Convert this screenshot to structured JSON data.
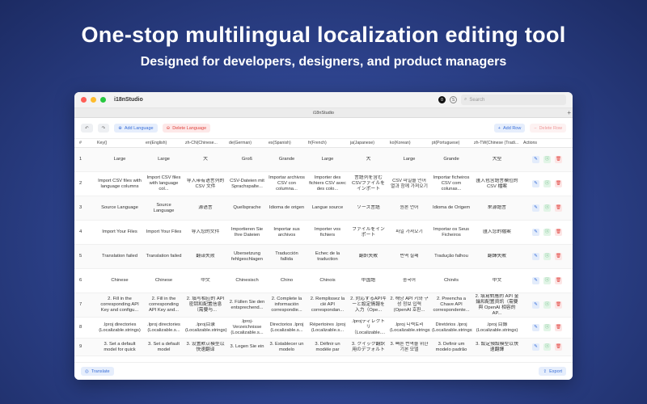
{
  "hero": {
    "title": "One-stop multilingual localization editing tool",
    "subtitle": "Designed for developers, designers, and product managers"
  },
  "window": {
    "app_name": "i18nStudio",
    "tab_title": "i18nStudio",
    "search_placeholder": "Search",
    "badge_left": "0",
    "badge_right": "S"
  },
  "toolbar": {
    "undo": "↶",
    "redo": "↷",
    "add_language": "Add Language",
    "delete_language": "Delete Language",
    "add_row": "Add Row",
    "delete_row": "Delete Row"
  },
  "table": {
    "headers": [
      "#",
      "Key()",
      "en(English)",
      "zh-CN(Chinese...",
      "de(German)",
      "es(Spanish)",
      "fr(French)",
      "ja(Japanese)",
      "ko(Korean)",
      "pt(Portuguese)",
      "zh-TW(Chinese (Tradi...",
      "Actions"
    ],
    "rows": [
      [
        "1",
        "Large",
        "Large",
        "大",
        "Groß",
        "Grande",
        "Large",
        "大",
        "Large",
        "Grande",
        "大型"
      ],
      [
        "2",
        "Import CSV files with language columns",
        "Import CSV files with language col...",
        "导入带有语言列的 CSV 文件",
        "CSV-Dateien mit Sprachspalte...",
        "Importar archivos CSV con columna...",
        "Importer des fichiers CSV avec des colo...",
        "言語列を含む CSVファイルをインポート",
        "CSV 파일을 언어 열과 함께 가져오기",
        "Importar ficheiros CSV com colunas...",
        "匯入包含語言欄位的 CSV 檔案"
      ],
      [
        "3",
        "Source Language",
        "Source Language",
        "源语言",
        "Quellsprache",
        "Idioma de origen",
        "Langue source",
        "ソース言語",
        "원본 언어",
        "Idioma de Origem",
        "來源語言"
      ],
      [
        "4",
        "Import Your Files",
        "Import Your Files",
        "导入您的文件",
        "Importieren Sie Ihre Dateien",
        "Importar sus archivos",
        "Importer vos fichiers",
        "ファイルをインポート",
        "파일 가져오기",
        "Importar os Seus Ficheiros",
        "匯入您的檔案"
      ],
      [
        "5",
        "Translation failed",
        "Translation failed",
        "翻译失败",
        "Übersetzung fehlgeschlagen",
        "Traducción fallida",
        "Échec de la traduction",
        "翻訳失敗",
        "번역 실패",
        "Tradução falhou",
        "翻譯失敗"
      ],
      [
        "6",
        "Chinese",
        "Chinese",
        "中文",
        "Chinesisch",
        "Chino",
        "Chinois",
        "中国語",
        "중국어",
        "Chinês",
        "中文"
      ],
      [
        "7",
        "2. Fill in the corresponding API Key and configu...",
        "2. Fill in the corresponding API Key and...",
        "2. 填写相应的 API密钥和配置信息（需要与...",
        "2. Füllen Sie den entsprechend...",
        "2. Complete la información correspondie...",
        "2. Remplissez la clé API correspondan...",
        "2. 対応するAPIキーと設定情報を入力（Ope...",
        "2. 해당 API 키와 구성 정보 입력 (OpenAI 호환...",
        "2. Preencha a Chave API correspondente...",
        "2. 填寫對應的 API 金鑰和配置資訊（需要與 OpenAI 相容的 AP..."
      ],
      [
        "8",
        ".lproj directories (Localizable.strings)",
        ".lproj directories (Localizable.s...",
        ".lproj目录 (Localizable.strings)",
        ".lproj-Verzeichnisse (Localizable.s...",
        "Directorios .lproj (Localizable.s...",
        "Répertoires .lproj (Localizable.s...",
        ".lprojディレクトリ（Localizable....",
        ".lproj 디렉토리 (Localizable.strings)",
        "Diretórios .lproj (Localizable.strings)",
        ".lproj 目錄 (Localizable.strings)"
      ],
      [
        "9",
        "3. Set a default model for quick",
        "3. Set a default model",
        "3. 设置默认模型以快速翻译",
        "3. Legen Sie ein",
        "3. Establecer un modelo",
        "3. Définir un modèle par",
        "3. クイック翻訳用のデフォルト",
        "3. 빠른 번역을 위한 기본 모델",
        "3. Definir um modelo padrão",
        "3. 設定預設模型以快速翻譯"
      ]
    ]
  },
  "footer": {
    "translate": "Translate",
    "export": "Export"
  }
}
